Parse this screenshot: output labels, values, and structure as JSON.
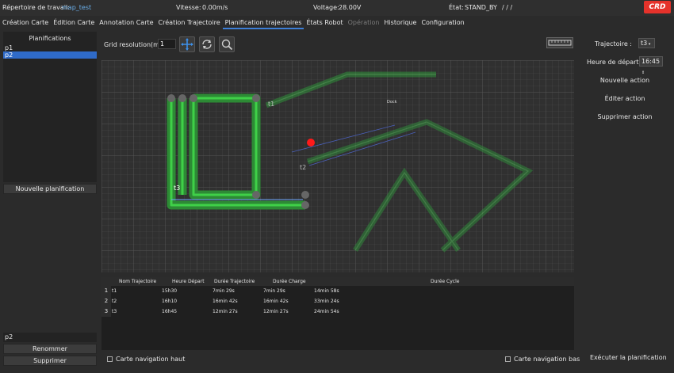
{
  "status": {
    "workdir_label": "Répertoire de travail:",
    "workdir_value": "map_test",
    "speed_label": "Vitesse:",
    "speed_value": "0.00m/s",
    "voltage_label": "Voltage:",
    "voltage_value": "28.00V",
    "state_label": "État:",
    "state_value": "STAND_BY",
    "state_extra": "/   /   /",
    "logo_text": "CRD"
  },
  "tabs": [
    {
      "label": "Création Carte"
    },
    {
      "label": "Édition Carte"
    },
    {
      "label": "Annotation Carte"
    },
    {
      "label": "Création Trajectoire"
    },
    {
      "label": "Planification trajectoires"
    },
    {
      "label": "États Robot"
    },
    {
      "label": "Opération"
    },
    {
      "label": "Historique"
    },
    {
      "label": "Configuration"
    }
  ],
  "left": {
    "title": "Planifications",
    "items": [
      "p1",
      "p2"
    ],
    "new_button": "Nouvelle planification",
    "name_value": "p2",
    "rename_button": "Renommer",
    "delete_button": "Supprimer"
  },
  "toolbar": {
    "grid_label": "Grid resolution(m):",
    "grid_value": "1"
  },
  "map": {
    "label_t1": "t1",
    "label_t2": "t2",
    "label_t3": "t3",
    "label_dock": "Dock"
  },
  "table": {
    "headers": [
      "Nom Trajectoire",
      "Heure Départ",
      "Durée Trajectoire",
      "Durée Charge",
      "Durée Cycle"
    ],
    "rows": [
      {
        "idx": "1",
        "name": "t1",
        "start": "15h30",
        "traj": "7min 29s",
        "charge": "7min 29s",
        "cycle": "14min 58s"
      },
      {
        "idx": "2",
        "name": "t2",
        "start": "16h10",
        "traj": "16min 42s",
        "charge": "16min 42s",
        "cycle": "33min 24s"
      },
      {
        "idx": "3",
        "name": "t3",
        "start": "16h45",
        "traj": "12min 27s",
        "charge": "12min 27s",
        "cycle": "24min 54s"
      }
    ]
  },
  "bottom": {
    "nav_top": "Carte navigation haut",
    "nav_bottom": "Carte navigation bas",
    "execute_button": "Exécuter la planification"
  },
  "right": {
    "traj_label": "Trajectoire :",
    "traj_value": "t3",
    "start_label": "Heure de départ :",
    "start_value": "16:45",
    "new_action": "Nouvelle action",
    "edit_action": "Éditer action",
    "delete_action": "Supprimer action"
  },
  "colors": {
    "accent": "#2f6bc9",
    "path_green": "#35c23a",
    "robot_red": "#ff1a1a",
    "link_blue": "#6aaee8"
  }
}
